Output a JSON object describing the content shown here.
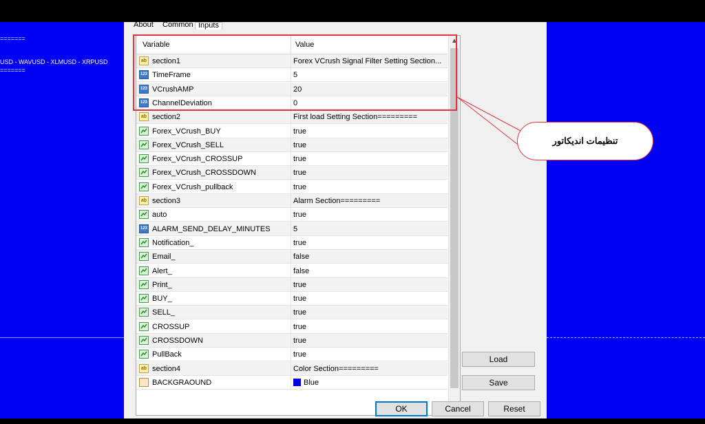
{
  "chart": {
    "line1": "=======",
    "line2": "USD - WAVUSD - XLMUSD - XRPUSD",
    "line3": "======="
  },
  "tabs": [
    "About",
    "Common",
    "Inputs"
  ],
  "columns": {
    "variable": "Variable",
    "value": "Value"
  },
  "rows": [
    {
      "icon": "ab",
      "variable": "section1",
      "value": "Forex VCrush Signal Filter  Setting Section..."
    },
    {
      "icon": "123",
      "variable": "TimeFrame",
      "value": "5"
    },
    {
      "icon": "123",
      "variable": "VCrushAMP",
      "value": "20"
    },
    {
      "icon": "123",
      "variable": "ChannelDeviation",
      "value": "0"
    },
    {
      "icon": "ab",
      "variable": "section2",
      "value": "First load Setting Section========="
    },
    {
      "icon": "bool",
      "variable": "Forex_VCrush_BUY",
      "value": "true"
    },
    {
      "icon": "bool",
      "variable": "Forex_VCrush_SELL",
      "value": "true"
    },
    {
      "icon": "bool",
      "variable": "Forex_VCrush_CROSSUP",
      "value": "true"
    },
    {
      "icon": "bool",
      "variable": "Forex_VCrush_CROSSDOWN",
      "value": "true"
    },
    {
      "icon": "bool",
      "variable": "Forex_VCrush_pullback",
      "value": "true"
    },
    {
      "icon": "ab",
      "variable": "section3",
      "value": "Alarm Section========="
    },
    {
      "icon": "bool",
      "variable": "auto",
      "value": "true"
    },
    {
      "icon": "123",
      "variable": "ALARM_SEND_DELAY_MINUTES",
      "value": "5"
    },
    {
      "icon": "bool",
      "variable": "Notification_",
      "value": "true"
    },
    {
      "icon": "bool",
      "variable": "Email_",
      "value": "false"
    },
    {
      "icon": "bool",
      "variable": "Alert_",
      "value": "false"
    },
    {
      "icon": "bool",
      "variable": "Print_",
      "value": "true"
    },
    {
      "icon": "bool",
      "variable": "BUY_",
      "value": "true"
    },
    {
      "icon": "bool",
      "variable": "SELL_",
      "value": "true"
    },
    {
      "icon": "bool",
      "variable": "CROSSUP",
      "value": "true"
    },
    {
      "icon": "bool",
      "variable": "CROSSDOWN",
      "value": "true"
    },
    {
      "icon": "bool",
      "variable": "PullBack",
      "value": "true"
    },
    {
      "icon": "ab",
      "variable": "section4",
      "value": "Color Section========="
    },
    {
      "icon": "color",
      "variable": "BACKGRAOUND",
      "value": "Blue",
      "swatch": "#0000e6"
    }
  ],
  "buttons": {
    "load": "Load",
    "save": "Save",
    "ok": "OK",
    "cancel": "Cancel",
    "reset": "Reset"
  },
  "callout": "تنظیمات اندیکاتور",
  "colors": {
    "chart_bg": "#0000f2",
    "highlight": "#e3333f",
    "accent": "#0078d7"
  }
}
